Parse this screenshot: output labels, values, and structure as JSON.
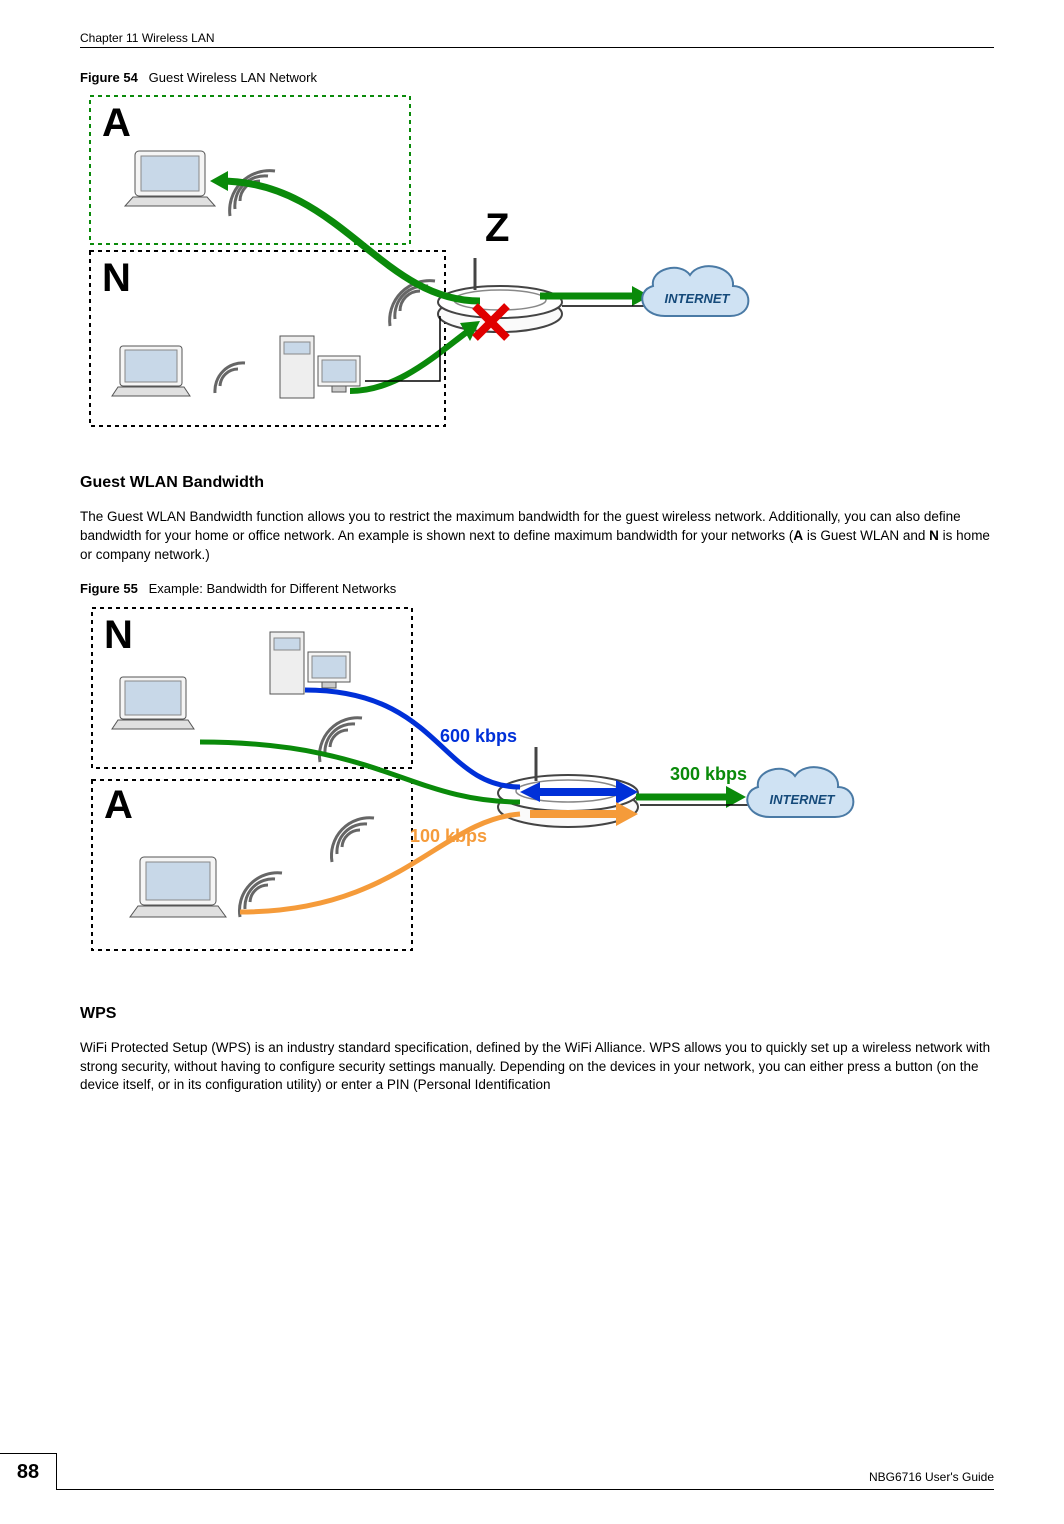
{
  "header": {
    "chapter": "Chapter 11 Wireless LAN"
  },
  "figure54": {
    "caption_prefix": "Figure 54",
    "caption_text": "Guest Wireless LAN Network",
    "label_A": "A",
    "label_N": "N",
    "label_Z": "Z",
    "internet_label": "INTERNET"
  },
  "section_guest_bw": {
    "heading": "Guest WLAN Bandwidth",
    "paragraph_before_bold1": "The Guest WLAN Bandwidth function allows you to restrict the maximum bandwidth for the guest wireless network. Additionally, you can also define bandwidth for your home or office network. An example is shown next to define maximum bandwidth for your networks (",
    "bold1": "A",
    "paragraph_mid": " is Guest WLAN and ",
    "bold2": "N",
    "paragraph_after": " is home or company network.)"
  },
  "figure55": {
    "caption_prefix": "Figure 55",
    "caption_text": "Example: Bandwidth for Different Networks",
    "label_N": "N",
    "label_A": "A",
    "kbps_600": "600 kbps",
    "kbps_300": "300 kbps",
    "kbps_100": "100 kbps",
    "internet_label": "INTERNET"
  },
  "section_wps": {
    "heading": "WPS",
    "paragraph": "WiFi Protected Setup (WPS) is an industry standard specification, defined by the WiFi Alliance. WPS allows you to quickly set up a wireless network with strong security, without having to configure security settings manually. Depending on the devices in your network, you can either press a button (on the device itself, or in its configuration utility) or enter a PIN (Personal Identification"
  },
  "footer": {
    "page_number": "88",
    "guide": "NBG6716 User's Guide"
  },
  "colors": {
    "green": "#0a8a0a",
    "blue": "#0030d8",
    "orange": "#f59b3a",
    "red": "#e00000"
  }
}
